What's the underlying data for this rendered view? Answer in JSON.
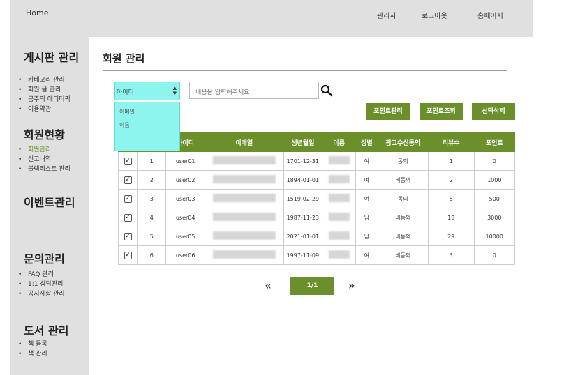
{
  "header": {
    "home": "Home",
    "nav": [
      "관리자",
      "로그아웃",
      "홈페이지"
    ]
  },
  "sidebar": {
    "sections": [
      {
        "title": "게시판 관리",
        "items": [
          "카테고리 관리",
          "회원 글 관리",
          "금주의 에디터픽",
          "이용약관"
        ]
      },
      {
        "title": "회원현황",
        "items": [
          "회원관리",
          "신고내역",
          "블랙리스트 관리"
        ]
      },
      {
        "title": "이벤트관리",
        "items": []
      },
      {
        "title": "문의관리",
        "items": [
          "FAQ 관리",
          "1:1 상담관리",
          "공지사항 관리"
        ]
      },
      {
        "title": "도서 관리",
        "items": [
          "책 등록",
          "책 관리"
        ]
      }
    ]
  },
  "main": {
    "title": "회원 관리",
    "search": {
      "selected": "아이디",
      "options": [
        "이메일",
        "이름"
      ],
      "placeholder": "내용을 입력해주세요"
    },
    "buttons": {
      "point_manage": "포인트관리",
      "point_view": "포인트조회",
      "delete_selected": "선택삭제"
    },
    "table": {
      "headers": [
        "",
        "",
        "아이디",
        "이메일",
        "생년월일",
        "이름",
        "성별",
        "광고수신동의",
        "리뷰수",
        "포인트"
      ],
      "rows": [
        {
          "no": "1",
          "id": "user01",
          "birth": "1701-12-31",
          "gender": "여",
          "ad": "동의",
          "reviews": "1",
          "points": "0"
        },
        {
          "no": "2",
          "id": "user02",
          "birth": "1894-01-01",
          "gender": "여",
          "ad": "비동의",
          "reviews": "2",
          "points": "1000"
        },
        {
          "no": "3",
          "id": "user03",
          "birth": "1519-02-29",
          "gender": "여",
          "ad": "동의",
          "reviews": "5",
          "points": "500"
        },
        {
          "no": "4",
          "id": "user04",
          "birth": "1987-11-23",
          "gender": "남",
          "ad": "비동의",
          "reviews": "18",
          "points": "3000"
        },
        {
          "no": "5",
          "id": "user05",
          "birth": "2021-01-01",
          "gender": "남",
          "ad": "비동의",
          "reviews": "29",
          "points": "10000"
        },
        {
          "no": "6",
          "id": "user06",
          "birth": "1997-11-09",
          "gender": "여",
          "ad": "비동의",
          "reviews": "3",
          "points": "0"
        }
      ]
    },
    "pagination": {
      "prev": "«",
      "current": "1/1",
      "next": "»"
    }
  },
  "colors": {
    "accent": "#6b8f2a",
    "dropdown": "#8ef4ee",
    "chrome": "#e0e0e0"
  }
}
